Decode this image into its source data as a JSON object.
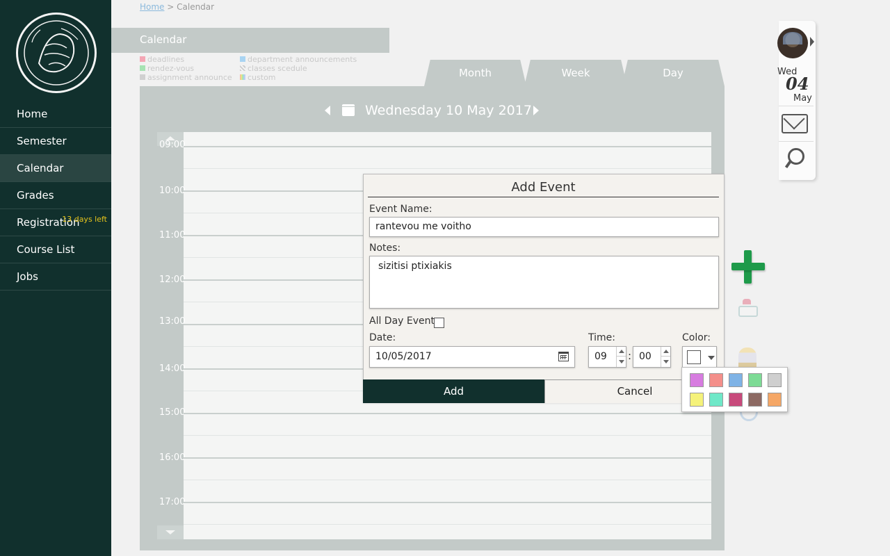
{
  "breadcrumb": {
    "home": "Home",
    "separator": " > ",
    "current": "Calendar"
  },
  "section_header": "Calendar",
  "sidebar": {
    "items": [
      {
        "label": "Home"
      },
      {
        "label": "Semester"
      },
      {
        "label": "Calendar"
      },
      {
        "label": "Grades"
      },
      {
        "label": "Registration",
        "badge": "13 days left"
      },
      {
        "label": "Course List"
      },
      {
        "label": "Jobs"
      }
    ],
    "active": "Calendar"
  },
  "legend": {
    "items": [
      {
        "label": "deadlines",
        "color": "#f4a7b5"
      },
      {
        "label": "department announcements",
        "color": "#a9d4f2"
      },
      {
        "label": "rendez-vous",
        "color": "#a6e3b3"
      },
      {
        "label": "classes scedule",
        "color": "#dddddd"
      },
      {
        "label": "assignment announce",
        "color": "#d0d0d0"
      },
      {
        "label": "custom",
        "color": "#d7c6f0"
      }
    ]
  },
  "tabs": [
    {
      "label": "Month"
    },
    {
      "label": "Week"
    },
    {
      "label": "Day",
      "active": true
    }
  ],
  "calendar": {
    "date_title": "Wednesday 10 May 2017",
    "hours": [
      "09:00",
      "10:00",
      "11:00",
      "12:00",
      "13:00",
      "14:00",
      "15:00",
      "16:00",
      "17:00"
    ]
  },
  "utility": {
    "dow": "Wed",
    "day": "04",
    "month": "May"
  },
  "modal": {
    "title": "Add Event",
    "event_name_label": "Event Name:",
    "event_name_value": "rantevou me voitho",
    "notes_label": "Notes:",
    "notes_value": "sizitisi ptixiakis",
    "all_day_label": "All Day Event",
    "all_day_checked": false,
    "date_label": "Date:",
    "date_value": "10/05/2017",
    "time_label": "Time:",
    "hour_value": "09",
    "time_separator": ":",
    "minute_value": "00",
    "color_label": "Color:",
    "selected_color": "#ffffff",
    "add_label": "Add",
    "cancel_label": "Cancel"
  },
  "palette": {
    "colors": [
      "#d77ce0",
      "#f48f8a",
      "#7fb3e6",
      "#7ddb95",
      "#cfcfcf",
      "#f5f27a",
      "#6fe8c8",
      "#c84a7c",
      "#8d6a63",
      "#f5a766"
    ]
  },
  "icons": {
    "add": "plus-icon",
    "mail": "mail-icon",
    "search": "search-icon"
  },
  "colors": {
    "sidebar_bg": "#11302d",
    "panel_bg": "#c3cac8",
    "accent_green": "#1e9a4a",
    "badge_yellow": "#e5c31c"
  }
}
